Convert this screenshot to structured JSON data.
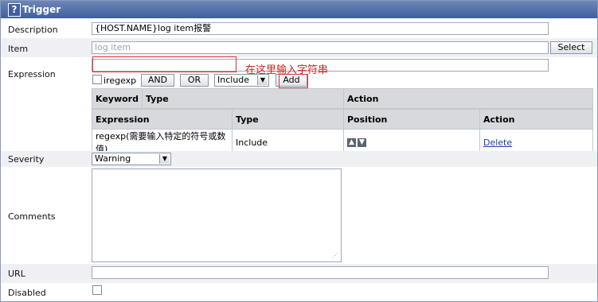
{
  "title": "Trigger",
  "labels": {
    "description": "Description",
    "item": "Item",
    "expression": "Expression",
    "severity": "Severity",
    "comments": "Comments",
    "url": "URL",
    "disabled": "Disabled"
  },
  "description_value": "{HOST.NAME}log item报警",
  "item_placeholder": "log item",
  "select_label": "Select",
  "expression_value": "",
  "annotation_note": "在这里输入字符串",
  "iregexp_label": "iregexp",
  "and_label": "AND",
  "or_label": "OR",
  "include_option": "Include",
  "add_label": "Add",
  "keyword_table": {
    "headers": [
      "Keyword",
      "Type",
      "Action"
    ]
  },
  "expression_table": {
    "headers": [
      "Expression",
      "Type",
      "Position",
      "Action"
    ],
    "rows": [
      {
        "expression": "regexp(需要输入特定的符号或数值)",
        "type": "Include",
        "action": "Delete"
      }
    ]
  },
  "severity_value": "Warning",
  "comments_value": "",
  "url_value": "",
  "disabled_checked": false,
  "colors": {
    "titlebar": "#3f5f9c",
    "annotation": "#e03030",
    "link": "#1a3da8"
  }
}
